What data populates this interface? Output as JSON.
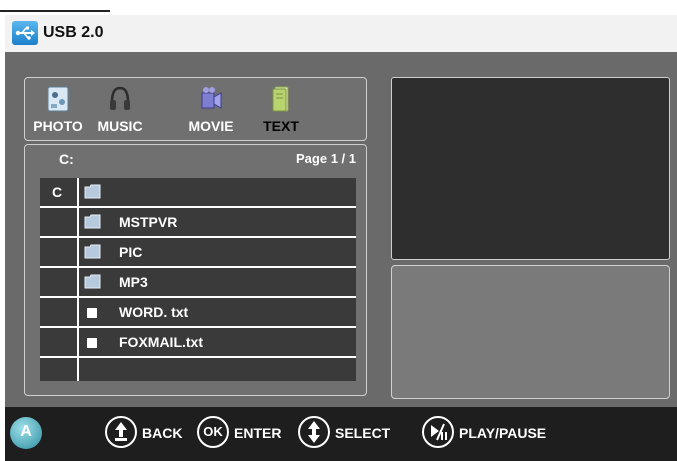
{
  "header": {
    "title": "USB 2.0",
    "icon": "usb-icon"
  },
  "tabs": [
    {
      "label": "PHOTO",
      "icon": "photo-icon",
      "selected": false
    },
    {
      "label": "MUSIC",
      "icon": "headphones-icon",
      "selected": false
    },
    {
      "label": "MOVIE",
      "icon": "movie-icon",
      "selected": false
    },
    {
      "label": "TEXT",
      "icon": "text-file-icon",
      "selected": true
    }
  ],
  "browser": {
    "drive": "C:",
    "page": "Page 1 / 1",
    "rows": [
      {
        "drive": "C",
        "type": "folder",
        "name": ""
      },
      {
        "drive": "",
        "type": "folder",
        "name": "MSTPVR"
      },
      {
        "drive": "",
        "type": "folder",
        "name": "PIC"
      },
      {
        "drive": "",
        "type": "folder",
        "name": "MP3"
      },
      {
        "drive": "",
        "type": "file",
        "name": "WORD. txt"
      },
      {
        "drive": "",
        "type": "file",
        "name": "FOXMAIL.txt"
      }
    ]
  },
  "footer": {
    "back_label": "BACK",
    "ok_button": "OK",
    "enter_label": "ENTER",
    "select_label": "SELECT",
    "playpause_label": "PLAY/PAUSE"
  },
  "colors": {
    "background": "#6a6a6a",
    "list": "#3a3a3a",
    "footer": "#1e1e1e",
    "preview": "#2e2e2e"
  }
}
